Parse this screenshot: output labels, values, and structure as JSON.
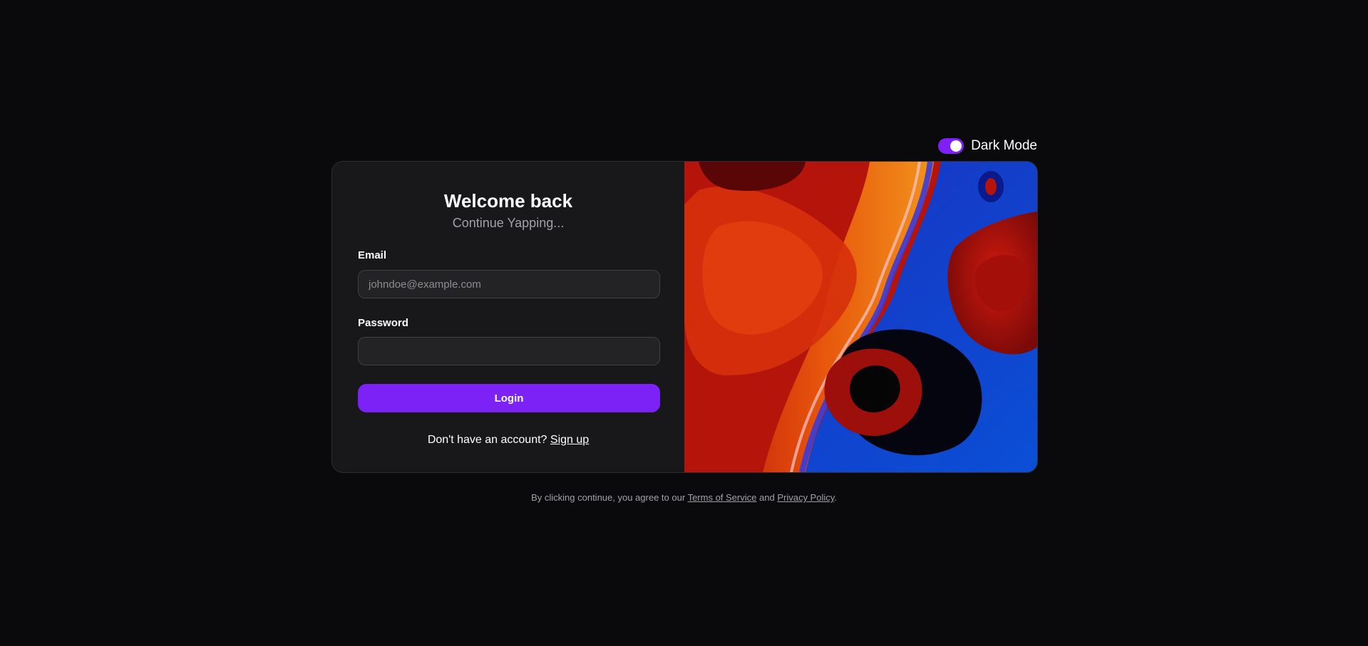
{
  "theme_toggle": {
    "label": "Dark Mode",
    "enabled": true,
    "accent_color": "#7c22f7"
  },
  "login": {
    "title": "Welcome back",
    "subtitle": "Continue Yapping...",
    "email_label": "Email",
    "email_placeholder": "johndoe@example.com",
    "email_value": "",
    "password_label": "Password",
    "password_value": "",
    "submit_label": "Login",
    "signup_prompt": "Don't have an account?",
    "signup_link": "Sign up"
  },
  "footer": {
    "prefix": "By clicking continue, you agree to our",
    "terms_link": "Terms of Service",
    "conjunction": "and",
    "privacy_link": "Privacy Policy",
    "suffix": "."
  },
  "colors": {
    "background": "#0a0a0c",
    "card": "#18181b",
    "accent": "#7c22f7"
  }
}
